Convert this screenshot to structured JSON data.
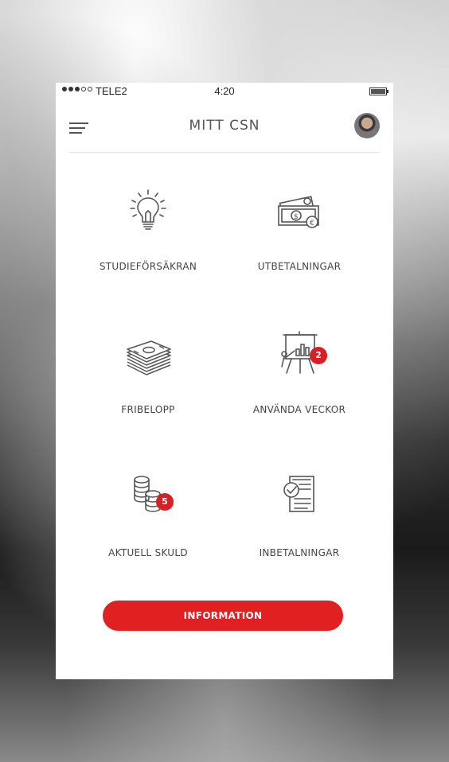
{
  "status_bar": {
    "carrier": "TELE2",
    "time": "4:20"
  },
  "header": {
    "title": "MITT CSN",
    "menu_icon": "menu-icon",
    "avatar": "avatar"
  },
  "tiles": [
    {
      "label": "STUDIEFÖRSÄKRAN",
      "icon": "lightbulb-icon"
    },
    {
      "label": "UTBETALNINGAR",
      "icon": "money-coins-icon"
    },
    {
      "label": "FRIBELOPP",
      "icon": "cash-stack-icon"
    },
    {
      "label": "ANVÄNDA VECKOR",
      "icon": "presentation-board-icon",
      "badge": "2"
    },
    {
      "label": "AKTUELL SKULD",
      "icon": "coin-stack-icon",
      "badge": "5"
    },
    {
      "label": "INBETALNINGAR",
      "icon": "document-check-icon"
    }
  ],
  "info_button": {
    "label": "INFORMATION"
  },
  "colors": {
    "accent": "#e02021",
    "badge": "#d91f26",
    "text": "#444444",
    "background": "#ffffff"
  }
}
